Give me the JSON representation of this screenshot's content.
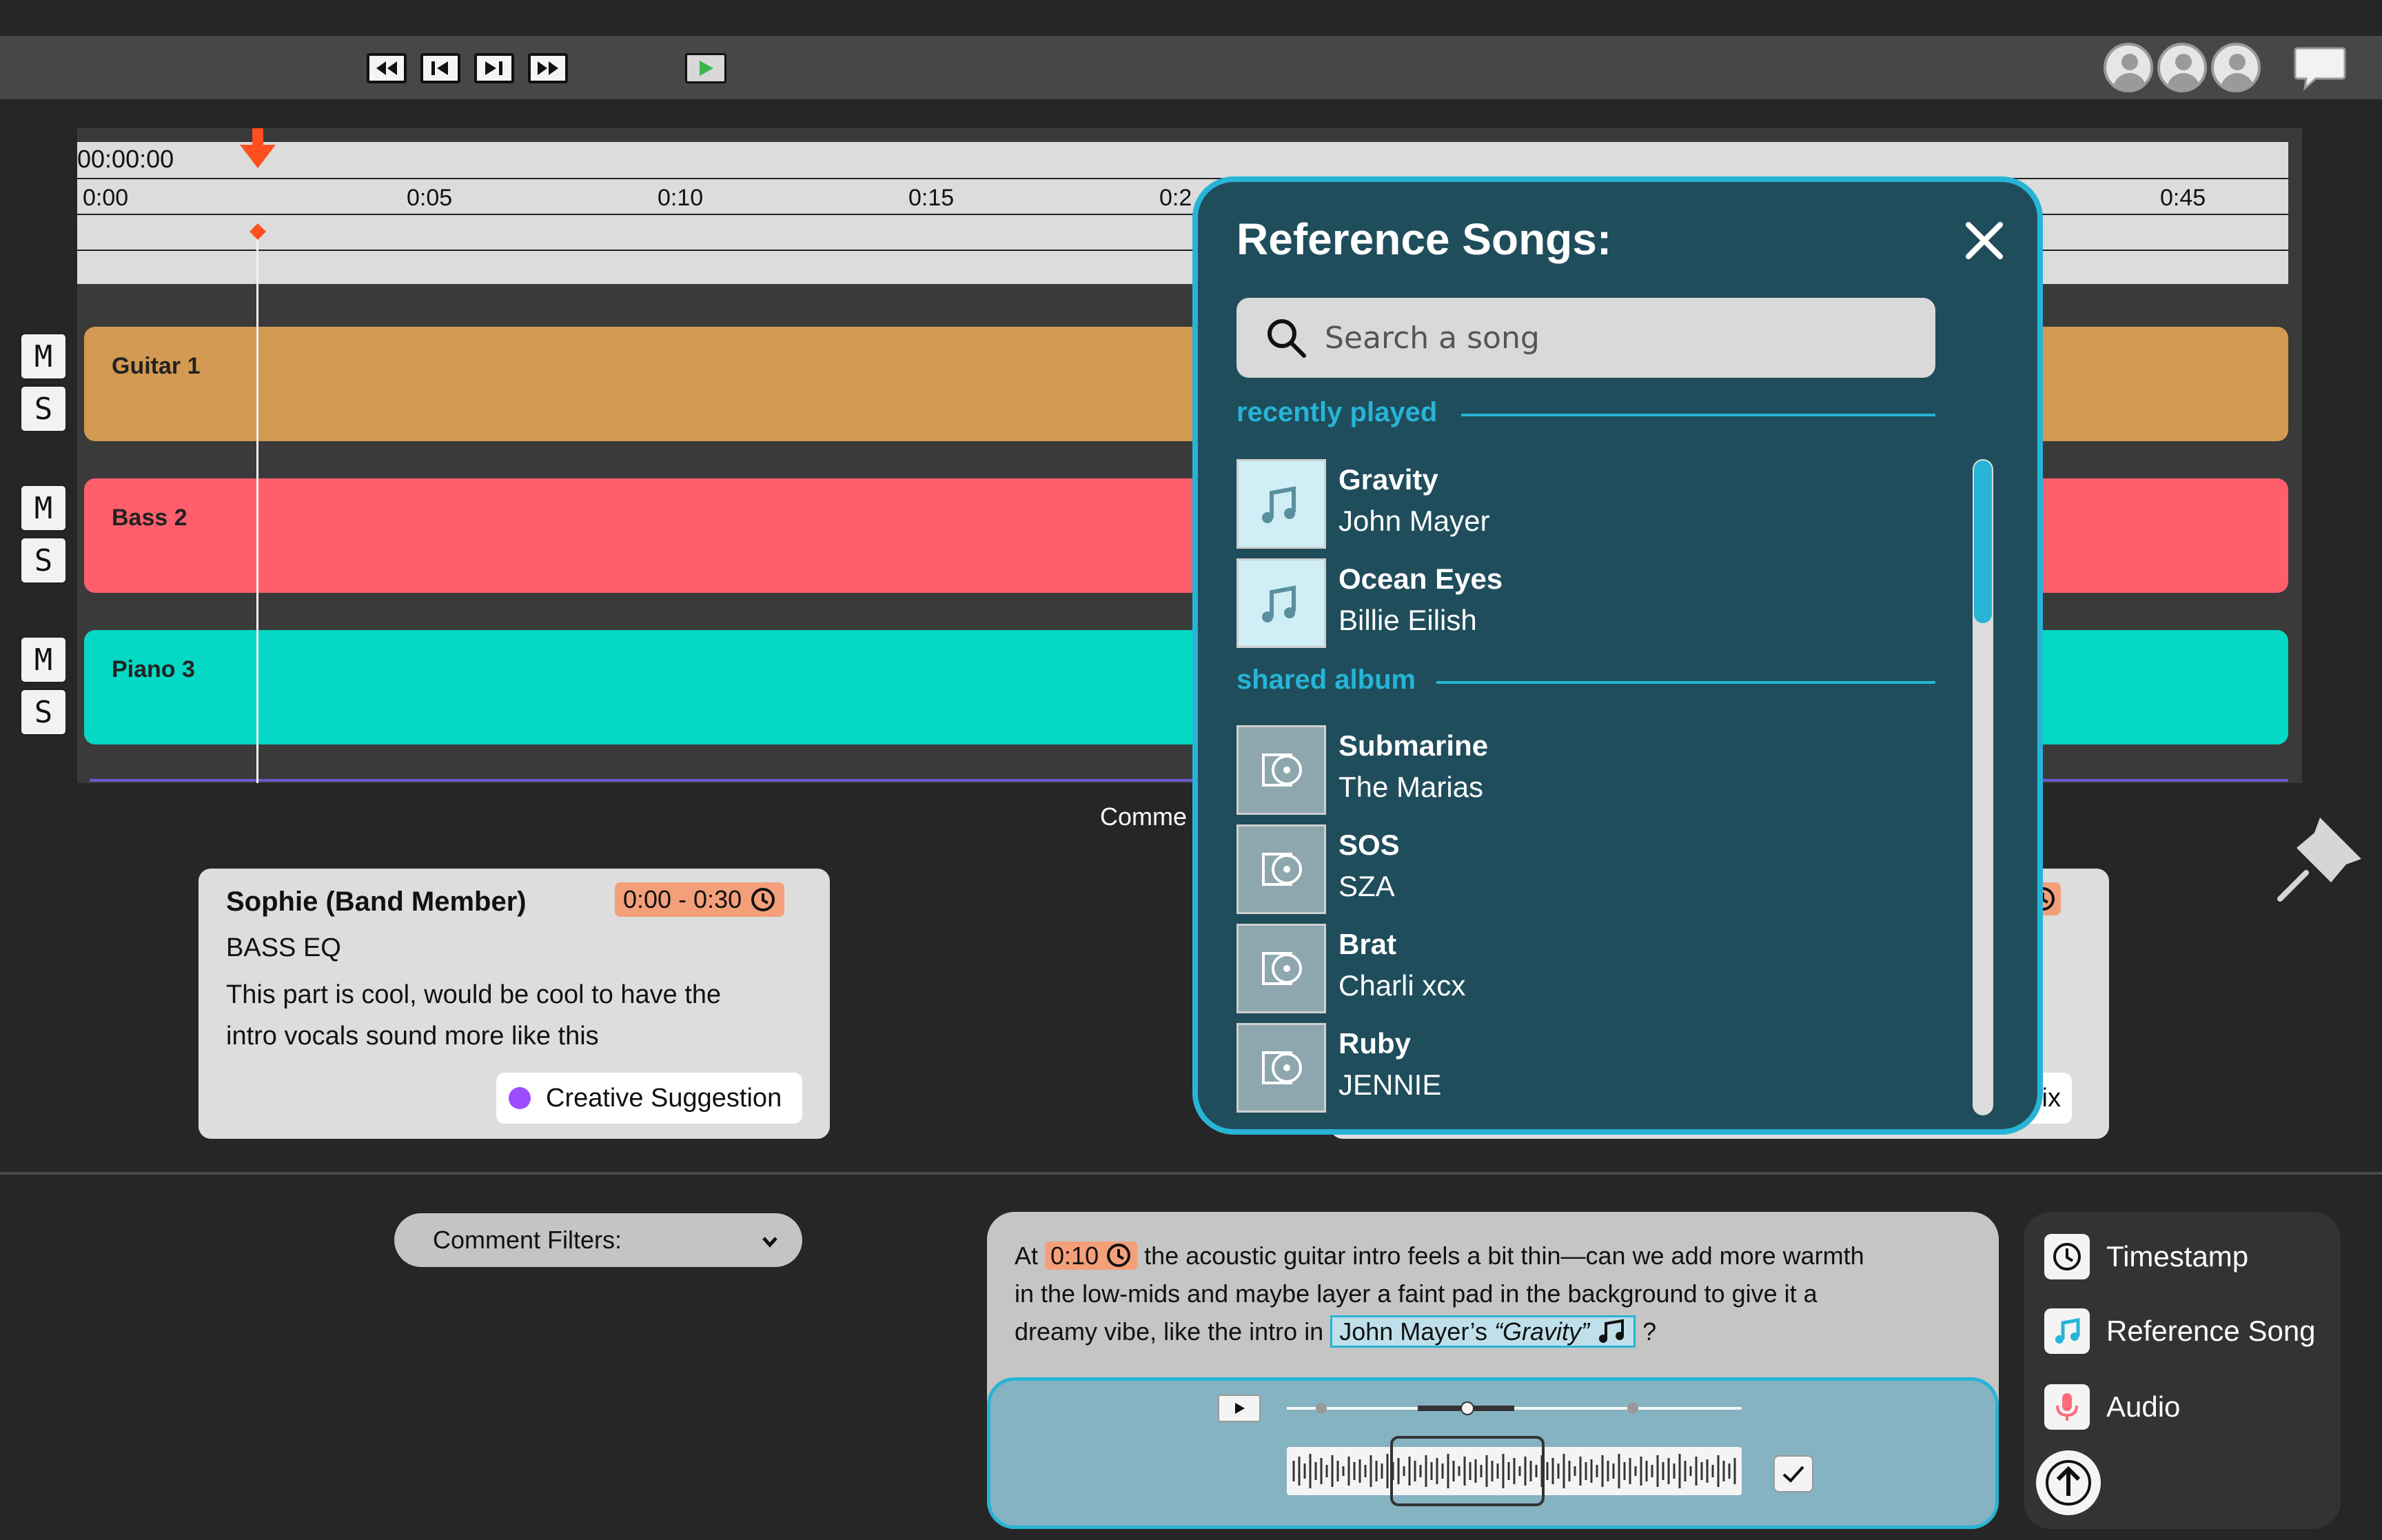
{
  "toolbar": {
    "transport": [
      "rewind-icon",
      "skip-back-icon",
      "play-pause-icon",
      "fast-forward-icon"
    ],
    "play": "play-icon",
    "collaborators": [
      "avatar",
      "avatar",
      "avatar"
    ],
    "chat": "chat-icon"
  },
  "timeline": {
    "timecode": "00:00:00",
    "ticks": [
      "0:00",
      "0:05",
      "0:10",
      "0:15",
      "0:2",
      "0:45"
    ],
    "tracks": [
      {
        "name": "Guitar 1",
        "color": "#d29a52",
        "mute": "M",
        "solo": "S"
      },
      {
        "name": "Bass 2",
        "color": "#ff5f6d",
        "mute": "M",
        "solo": "S"
      },
      {
        "name": "Piano 3",
        "color": "#05d8c4",
        "mute": "M",
        "solo": "S"
      }
    ],
    "playhead_color": "#ff4f1f"
  },
  "comments_header": "Comme",
  "comments": [
    {
      "author": "Sophie (Band Member)",
      "time": "0:00 - 0:30",
      "topic": "BASS EQ",
      "body_line1": "This part is cool, would be cool to have the",
      "body_line2": "intro vocals sound more like this",
      "tag": "Creative Suggestion",
      "tag_color": "#9b4dff"
    },
    {
      "tag_partial": "Fix"
    }
  ],
  "modal": {
    "title": "Reference Songs:",
    "search_placeholder": "Search a song",
    "recent_label": "recently played",
    "recent": [
      {
        "title": "Gravity",
        "artist": "John Mayer"
      },
      {
        "title": "Ocean Eyes",
        "artist": "Billie Eilish"
      }
    ],
    "shared_label": "shared album",
    "shared": [
      {
        "title": "Submarine",
        "artist": "The Marias"
      },
      {
        "title": "SOS",
        "artist": "SZA"
      },
      {
        "title": "Brat",
        "artist": "Charli xcx"
      },
      {
        "title": "Ruby",
        "artist": "JENNIE"
      }
    ],
    "accent": "#27b4d6",
    "background": "#1f4d5b"
  },
  "filters": {
    "label": "Comment Filters:"
  },
  "composer": {
    "prefix": "At",
    "time": "0:10",
    "text1": "the acoustic guitar intro feels a bit thin—can we add more warmth",
    "text2": "in the low-mids and maybe layer a faint pad in the background to give it a",
    "text3": "dreamy vibe, like the intro in",
    "ref_artist": "John Mayer’s",
    "ref_title": "“Gravity”",
    "suffix": "?"
  },
  "tools": {
    "timestamp": "Timestamp",
    "reference": "Reference Song",
    "audio": "Audio"
  }
}
